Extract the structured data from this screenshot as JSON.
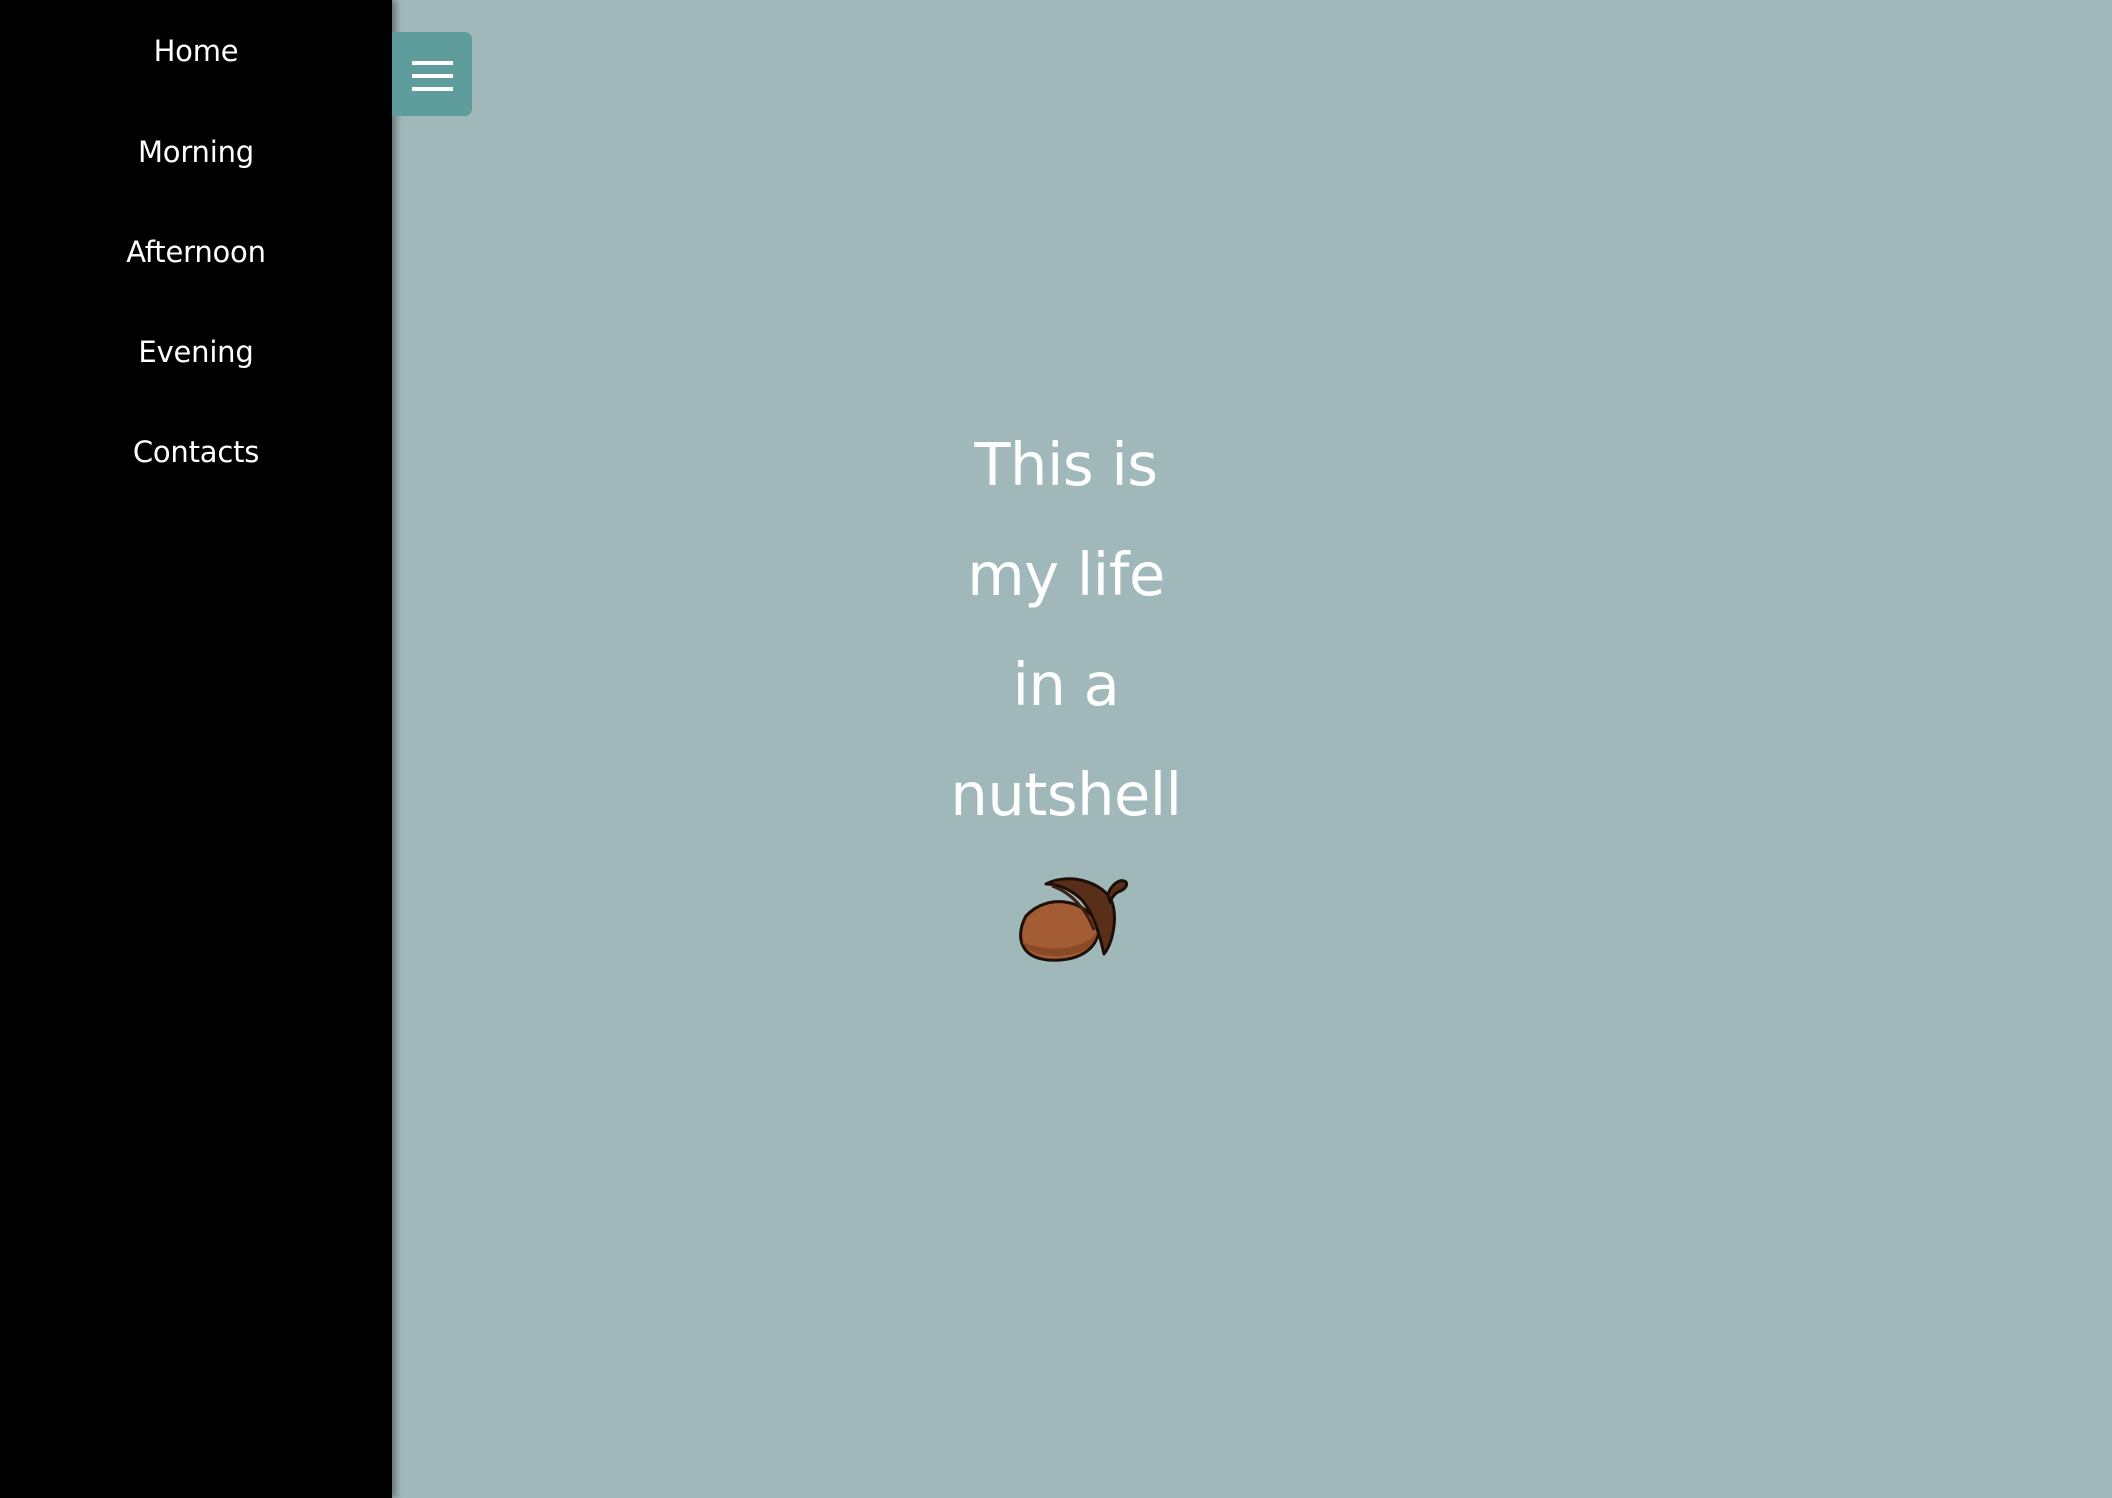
{
  "sidebar": {
    "items": [
      {
        "label": "Home"
      },
      {
        "label": "Morning"
      },
      {
        "label": "Afternoon"
      },
      {
        "label": "Evening"
      },
      {
        "label": "Contacts"
      }
    ]
  },
  "menu_toggle": {
    "icon": "hamburger-menu-icon",
    "color": "#5f9c9c"
  },
  "hero": {
    "lines": [
      "This is",
      "my life",
      "in a",
      "nutshell"
    ],
    "icon": "acorn-icon"
  },
  "colors": {
    "background": "#a0b8b9",
    "sidebar": "#000000",
    "text": "#ffffff",
    "acorn_cap": "#5a2f1a",
    "acorn_nut": "#a35c34"
  }
}
